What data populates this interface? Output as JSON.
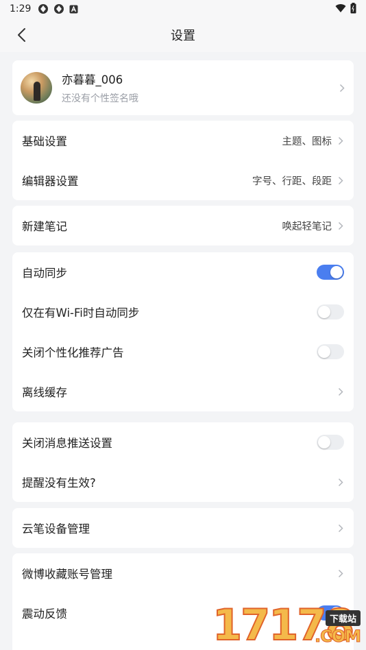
{
  "status_bar": {
    "time": "1:29",
    "left_icons": [
      "notification-icon",
      "notification-icon",
      "a-icon"
    ],
    "right_icons": [
      "wifi-icon",
      "battery-icon"
    ]
  },
  "header": {
    "title": "设置",
    "back_icon": "back-chevron-icon"
  },
  "profile": {
    "name": "亦暮暮_006",
    "signature": "还没有个性签名哦"
  },
  "sections": {
    "basic": {
      "label": "基础设置",
      "value": "主题、图标"
    },
    "editor": {
      "label": "编辑器设置",
      "value": "字号、行距、段距"
    },
    "new_note": {
      "label": "新建笔记",
      "value": "唤起轻笔记"
    },
    "auto_sync": {
      "label": "自动同步",
      "on": true
    },
    "wifi_sync": {
      "label": "仅在有Wi-Fi时自动同步",
      "on": false
    },
    "close_ads": {
      "label": "关闭个性化推荐广告",
      "on": false
    },
    "offline_cache": {
      "label": "离线缓存"
    },
    "close_push": {
      "label": "关闭消息推送设置",
      "on": false
    },
    "reminder": {
      "label": "提醒没有生效?"
    },
    "device_mgmt": {
      "label": "云笔设备管理"
    },
    "weibo": {
      "label": "微博收藏账号管理"
    },
    "vibration": {
      "label": "震动反馈",
      "on": true
    }
  },
  "colors": {
    "accent": "#4a7ef0",
    "background": "#f3f4f6",
    "card": "#ffffff",
    "secondary_text": "#9a9ea6"
  },
  "watermark": {
    "number": "17178",
    "tag": "下载站",
    "suffix": ".COM"
  }
}
